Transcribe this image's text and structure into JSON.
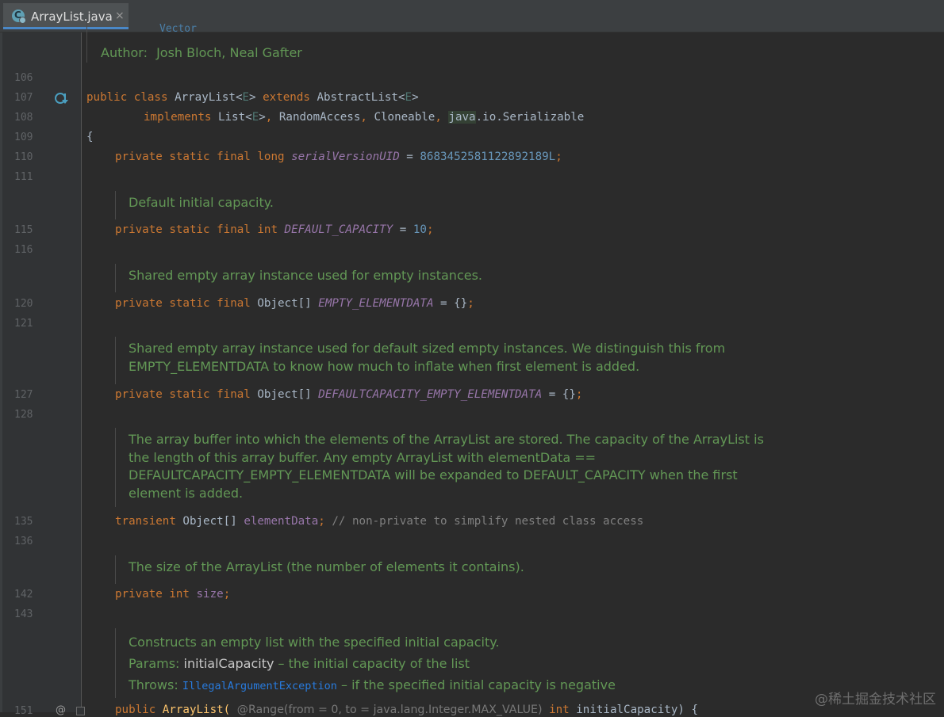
{
  "tab": {
    "label": "ArrayList.java",
    "close": "×",
    "icon": "java-class-icon"
  },
  "doc_top": {
    "partial": "Vector",
    "author_label": "Author:",
    "author_value": "Josh Bloch, Neal Gafter"
  },
  "line_numbers": {
    "l106": "106",
    "l107": "107",
    "l108": "108",
    "l109": "109",
    "l110": "110",
    "l111": "111",
    "l115": "115",
    "l116": "116",
    "l120": "120",
    "l121": "121",
    "l127": "127",
    "l128": "128",
    "l135": "135",
    "l136": "136",
    "l142": "142",
    "l143": "143",
    "l151": "151"
  },
  "code": {
    "l107": {
      "k1": "public",
      "k2": "class",
      "name": "ArrayList",
      "lt": "<",
      "e1": "E",
      "gt": ">",
      "k3": "extends",
      "sup": "AbstractList",
      "lt2": "<",
      "e2": "E",
      "gt2": ">"
    },
    "l108": {
      "k1": "implements",
      "t1": "List",
      "lt": "<",
      "e": "E",
      "gt": ">",
      "c1": ",",
      "t2": "RandomAccess",
      "c2": ",",
      "t3": "Cloneable",
      "c3": ",",
      "pkg": "java",
      "rest": ".io.Serializable"
    },
    "l109": "{",
    "l110": {
      "mods": "private static final long",
      "field": "serialVersionUID",
      "eq": " = ",
      "val": "8683452581122892189L",
      "semi": ";"
    },
    "l115": {
      "mods": "private static final int",
      "field": "DEFAULT_CAPACITY",
      "eq": " = ",
      "val": "10",
      "semi": ";"
    },
    "l120": {
      "mods": "private static final",
      "type": "Object[]",
      "field": "EMPTY_ELEMENTDATA",
      "rest": " = {}",
      "semi": ";"
    },
    "l127": {
      "mods": "private static final",
      "type": "Object[]",
      "field": "DEFAULTCAPACITY_EMPTY_ELEMENTDATA",
      "rest": " = {}",
      "semi": ";"
    },
    "l135": {
      "mods": "transient",
      "type": "Object[]",
      "field": "elementData",
      "semi": ";",
      "comment": "// non-private to simplify nested class access"
    },
    "l142": {
      "mods": "private int",
      "field": "size",
      "semi": ";"
    },
    "l151": {
      "mods": "public",
      "name": "ArrayList(",
      "ann": "@Range(from = 0, to = java.lang.Integer.MAX_VALUE)",
      "mods2": "int",
      "param": "initialCapacity) {"
    }
  },
  "docs": {
    "d1": "Default initial capacity.",
    "d2": "Shared empty array instance used for empty instances.",
    "d3a": "Shared empty array instance used for default sized empty instances. We distinguish this from",
    "d3b": "EMPTY_ELEMENTDATA to know how much to inflate when first element is added.",
    "d4a": "The array buffer into which the elements of the ArrayList are stored. The capacity of the ArrayList is",
    "d4b": "the length of this array buffer. Any empty ArrayList with elementData ==",
    "d4c": "DEFAULTCAPACITY_EMPTY_ELEMENTDATA will be expanded to DEFAULT_CAPACITY when the first",
    "d4d": "element is added.",
    "d5": "The size of the ArrayList (the number of elements it contains).",
    "d6": "Constructs an empty list with the specified initial capacity.",
    "d6_params_label": "Params:",
    "d6_params_name": "initialCapacity",
    "d6_params_desc": " – the initial capacity of the list",
    "d6_throws_label": "Throws:",
    "d6_throws_name": "IllegalArgumentException",
    "d6_throws_desc": " – if the specified initial capacity is negative"
  },
  "watermark": "@稀土掘金技术社区",
  "colors": {
    "background": "#2b2b2b",
    "keyword": "#cc7832",
    "field": "#9876aa",
    "number": "#6897bb",
    "doc": "#629755",
    "comment": "#808080"
  }
}
